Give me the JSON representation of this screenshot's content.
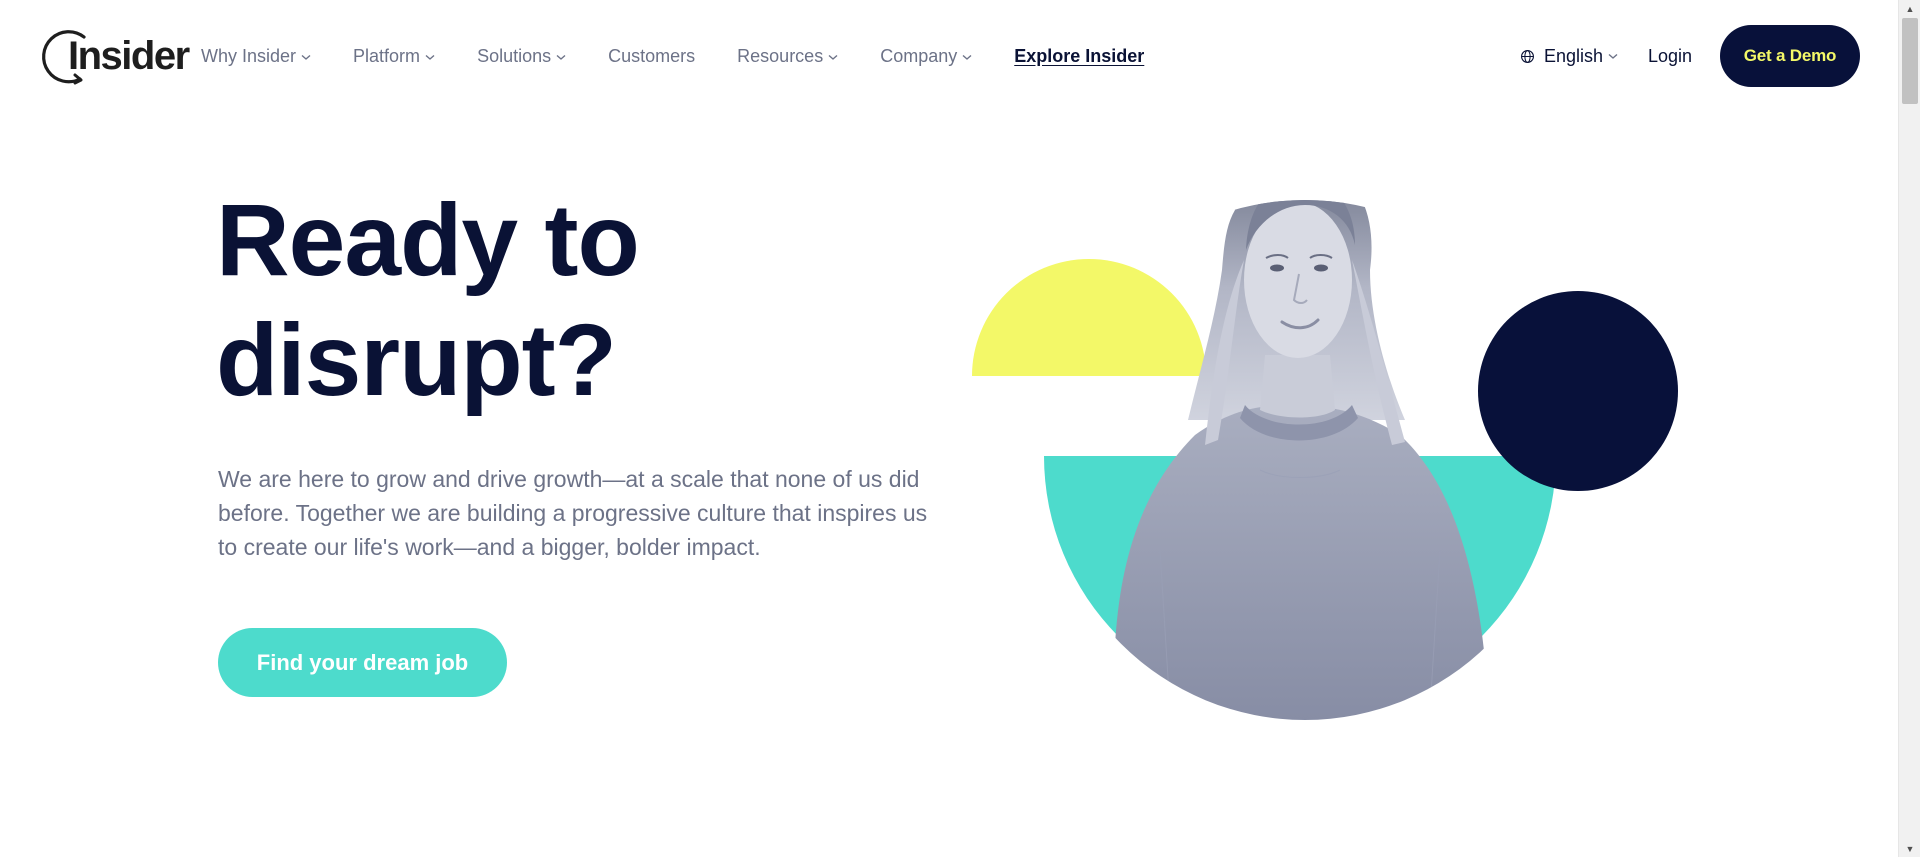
{
  "brand": {
    "logo_text": "Insider",
    "colors": {
      "navy": "#08113a",
      "yellow": "#f3f868",
      "teal": "#4ddbcc",
      "muted": "#6c7287"
    }
  },
  "nav": {
    "items": [
      {
        "label": "Why Insider",
        "has_dropdown": true
      },
      {
        "label": "Platform",
        "has_dropdown": true
      },
      {
        "label": "Solutions",
        "has_dropdown": true
      },
      {
        "label": "Customers",
        "has_dropdown": false
      },
      {
        "label": "Resources",
        "has_dropdown": true
      },
      {
        "label": "Company",
        "has_dropdown": true
      }
    ],
    "explore_label": "Explore Insider",
    "language_label": "English",
    "language_icon": "globe-icon",
    "login_label": "Login",
    "demo_label": "Get a Demo"
  },
  "hero": {
    "title_line1": "Ready to",
    "title_line2": "disrupt?",
    "description": "We are here to grow and drive growth—at a scale that none of us did before. Together we are building a progressive culture that inspires us to create our life's work—and a bigger, bolder impact.",
    "cta_label": "Find your dream job",
    "illustration_icons": [
      "yellow-half-circle",
      "teal-half-circle",
      "navy-circle",
      "person-photo"
    ]
  },
  "scrollbar": {
    "up_icon": "arrow-up-icon",
    "down_icon": "arrow-down-icon"
  }
}
